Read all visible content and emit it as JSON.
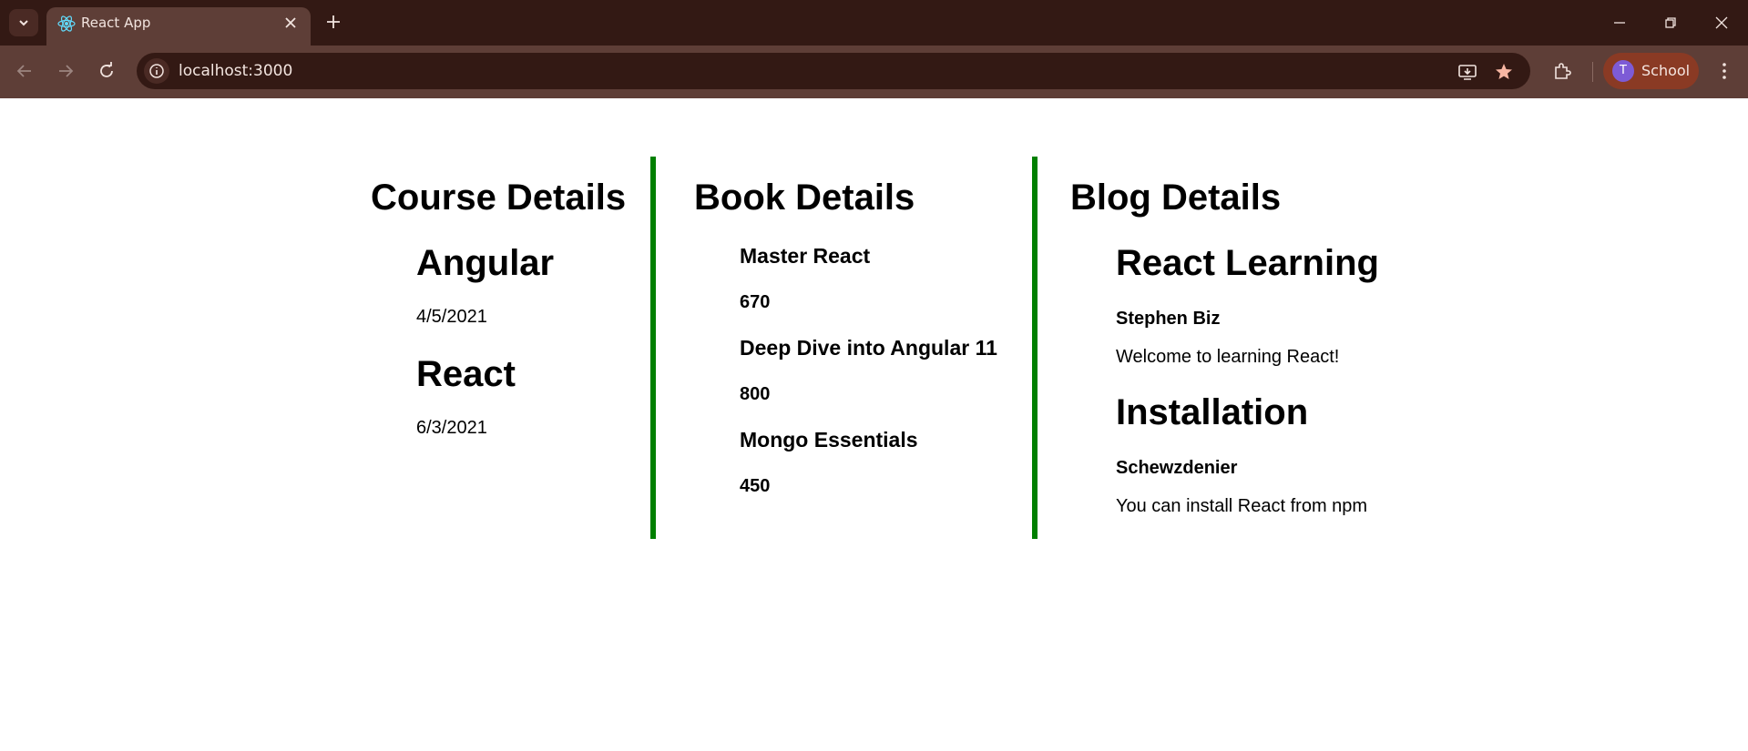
{
  "browser": {
    "tab_title": "React App",
    "url": "localhost:3000",
    "profile_initial": "T",
    "profile_name": "School"
  },
  "course": {
    "heading": "Course Details",
    "items": [
      {
        "name": "Angular",
        "date": "4/5/2021"
      },
      {
        "name": "React",
        "date": "6/3/2021"
      }
    ]
  },
  "book": {
    "heading": "Book Details",
    "items": [
      {
        "name": "Master React",
        "price": "670"
      },
      {
        "name": "Deep Dive into Angular 11",
        "price": "800"
      },
      {
        "name": "Mongo Essentials",
        "price": "450"
      }
    ]
  },
  "blog": {
    "heading": "Blog Details",
    "items": [
      {
        "title": "React Learning",
        "author": "Stephen Biz",
        "text": "Welcome to learning React!"
      },
      {
        "title": "Installation",
        "author": "Schewzdenier",
        "text": "You can install React from npm"
      }
    ]
  },
  "colors": {
    "divider": "#008000",
    "tabstrip": "#331914",
    "toolbar": "#5e3e37"
  }
}
